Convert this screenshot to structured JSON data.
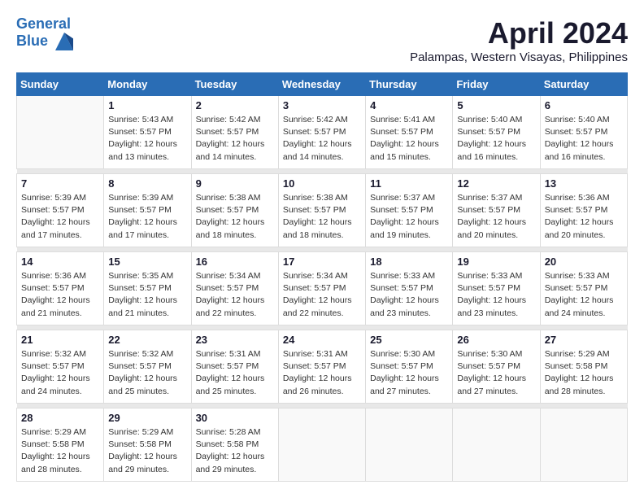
{
  "header": {
    "logo_line1": "General",
    "logo_line2": "Blue",
    "month": "April 2024",
    "location": "Palampas, Western Visayas, Philippines"
  },
  "days_of_week": [
    "Sunday",
    "Monday",
    "Tuesday",
    "Wednesday",
    "Thursday",
    "Friday",
    "Saturday"
  ],
  "weeks": [
    [
      {
        "day": "",
        "info": ""
      },
      {
        "day": "1",
        "info": "Sunrise: 5:43 AM\nSunset: 5:57 PM\nDaylight: 12 hours\nand 13 minutes."
      },
      {
        "day": "2",
        "info": "Sunrise: 5:42 AM\nSunset: 5:57 PM\nDaylight: 12 hours\nand 14 minutes."
      },
      {
        "day": "3",
        "info": "Sunrise: 5:42 AM\nSunset: 5:57 PM\nDaylight: 12 hours\nand 14 minutes."
      },
      {
        "day": "4",
        "info": "Sunrise: 5:41 AM\nSunset: 5:57 PM\nDaylight: 12 hours\nand 15 minutes."
      },
      {
        "day": "5",
        "info": "Sunrise: 5:40 AM\nSunset: 5:57 PM\nDaylight: 12 hours\nand 16 minutes."
      },
      {
        "day": "6",
        "info": "Sunrise: 5:40 AM\nSunset: 5:57 PM\nDaylight: 12 hours\nand 16 minutes."
      }
    ],
    [
      {
        "day": "7",
        "info": "Sunrise: 5:39 AM\nSunset: 5:57 PM\nDaylight: 12 hours\nand 17 minutes."
      },
      {
        "day": "8",
        "info": "Sunrise: 5:39 AM\nSunset: 5:57 PM\nDaylight: 12 hours\nand 17 minutes."
      },
      {
        "day": "9",
        "info": "Sunrise: 5:38 AM\nSunset: 5:57 PM\nDaylight: 12 hours\nand 18 minutes."
      },
      {
        "day": "10",
        "info": "Sunrise: 5:38 AM\nSunset: 5:57 PM\nDaylight: 12 hours\nand 18 minutes."
      },
      {
        "day": "11",
        "info": "Sunrise: 5:37 AM\nSunset: 5:57 PM\nDaylight: 12 hours\nand 19 minutes."
      },
      {
        "day": "12",
        "info": "Sunrise: 5:37 AM\nSunset: 5:57 PM\nDaylight: 12 hours\nand 20 minutes."
      },
      {
        "day": "13",
        "info": "Sunrise: 5:36 AM\nSunset: 5:57 PM\nDaylight: 12 hours\nand 20 minutes."
      }
    ],
    [
      {
        "day": "14",
        "info": "Sunrise: 5:36 AM\nSunset: 5:57 PM\nDaylight: 12 hours\nand 21 minutes."
      },
      {
        "day": "15",
        "info": "Sunrise: 5:35 AM\nSunset: 5:57 PM\nDaylight: 12 hours\nand 21 minutes."
      },
      {
        "day": "16",
        "info": "Sunrise: 5:34 AM\nSunset: 5:57 PM\nDaylight: 12 hours\nand 22 minutes."
      },
      {
        "day": "17",
        "info": "Sunrise: 5:34 AM\nSunset: 5:57 PM\nDaylight: 12 hours\nand 22 minutes."
      },
      {
        "day": "18",
        "info": "Sunrise: 5:33 AM\nSunset: 5:57 PM\nDaylight: 12 hours\nand 23 minutes."
      },
      {
        "day": "19",
        "info": "Sunrise: 5:33 AM\nSunset: 5:57 PM\nDaylight: 12 hours\nand 23 minutes."
      },
      {
        "day": "20",
        "info": "Sunrise: 5:33 AM\nSunset: 5:57 PM\nDaylight: 12 hours\nand 24 minutes."
      }
    ],
    [
      {
        "day": "21",
        "info": "Sunrise: 5:32 AM\nSunset: 5:57 PM\nDaylight: 12 hours\nand 24 minutes."
      },
      {
        "day": "22",
        "info": "Sunrise: 5:32 AM\nSunset: 5:57 PM\nDaylight: 12 hours\nand 25 minutes."
      },
      {
        "day": "23",
        "info": "Sunrise: 5:31 AM\nSunset: 5:57 PM\nDaylight: 12 hours\nand 25 minutes."
      },
      {
        "day": "24",
        "info": "Sunrise: 5:31 AM\nSunset: 5:57 PM\nDaylight: 12 hours\nand 26 minutes."
      },
      {
        "day": "25",
        "info": "Sunrise: 5:30 AM\nSunset: 5:57 PM\nDaylight: 12 hours\nand 27 minutes."
      },
      {
        "day": "26",
        "info": "Sunrise: 5:30 AM\nSunset: 5:57 PM\nDaylight: 12 hours\nand 27 minutes."
      },
      {
        "day": "27",
        "info": "Sunrise: 5:29 AM\nSunset: 5:58 PM\nDaylight: 12 hours\nand 28 minutes."
      }
    ],
    [
      {
        "day": "28",
        "info": "Sunrise: 5:29 AM\nSunset: 5:58 PM\nDaylight: 12 hours\nand 28 minutes."
      },
      {
        "day": "29",
        "info": "Sunrise: 5:29 AM\nSunset: 5:58 PM\nDaylight: 12 hours\nand 29 minutes."
      },
      {
        "day": "30",
        "info": "Sunrise: 5:28 AM\nSunset: 5:58 PM\nDaylight: 12 hours\nand 29 minutes."
      },
      {
        "day": "",
        "info": ""
      },
      {
        "day": "",
        "info": ""
      },
      {
        "day": "",
        "info": ""
      },
      {
        "day": "",
        "info": ""
      }
    ]
  ]
}
